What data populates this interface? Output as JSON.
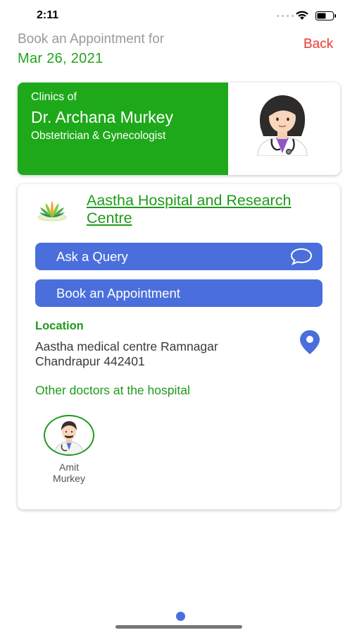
{
  "status_bar": {
    "time": "2:11",
    "signal_dots": "••••",
    "wifi_icon": "wifi-icon",
    "battery_icon": "battery-icon"
  },
  "header": {
    "subtitle": "Book an Appointment for",
    "date": "Mar 26, 2021",
    "back_label": "Back"
  },
  "doctor": {
    "clinics_label": "Clinics of",
    "name": "Dr. Archana Murkey",
    "specialty": "Obstetrician & Gynecologist",
    "avatar_icon": "female-doctor-avatar"
  },
  "hospital": {
    "name": "Aastha Hospital and Research Centre",
    "logo_icon": "hospital-logo",
    "query_button_label": "Ask a Query",
    "book_button_label": "Book an Appointment",
    "location_heading": "Location",
    "address_line1": "Aastha medical centre Ramnagar",
    "address_line2": "Chandrapur 442401",
    "other_doctors_heading": "Other doctors at the hospital",
    "other_doctors": [
      {
        "first_name": "Amit",
        "last_name": "Murkey",
        "avatar_icon": "male-doctor-avatar"
      }
    ]
  },
  "colors": {
    "brand_green": "#1ea91a",
    "action_blue": "#4a6fdc",
    "back_red": "#ea3a2e"
  },
  "pager": {
    "active_page": 1,
    "total_pages": 1
  }
}
